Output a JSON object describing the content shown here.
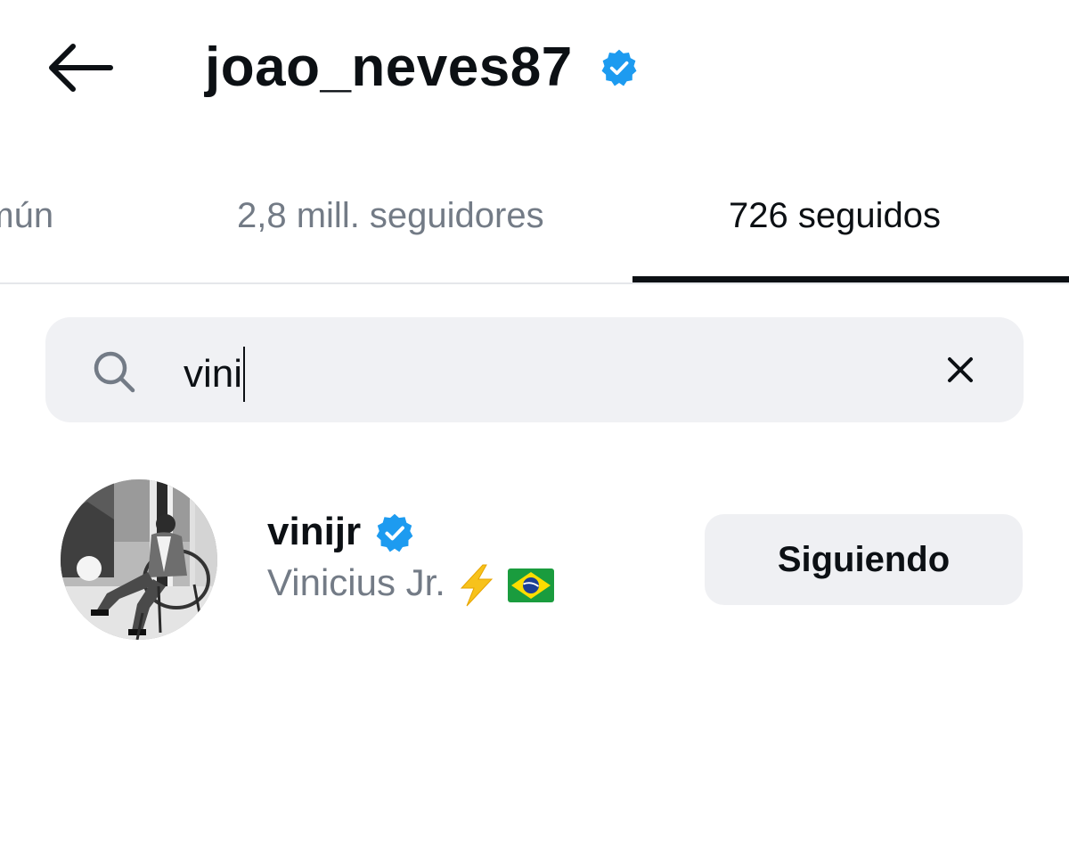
{
  "header": {
    "username": "joao_neves87",
    "verified": true,
    "back_icon": "arrow-left-icon"
  },
  "tabs": [
    {
      "label": "omún",
      "active": false
    },
    {
      "label": "2,8 mill. seguidores",
      "active": false
    },
    {
      "label": "726 seguidos",
      "active": true
    }
  ],
  "search": {
    "value": "vini",
    "icon": "search-icon",
    "clear_icon": "close-icon"
  },
  "results": [
    {
      "username": "vinijr",
      "verified": true,
      "full_name": "Vinicius Jr.",
      "emojis": [
        "lightning-icon",
        "brazil-flag-icon"
      ],
      "button_label": "Siguiendo"
    }
  ],
  "colors": {
    "verified_blue": "#1d9bf0",
    "secondary_text": "#737b86",
    "surface": "#f0f1f4"
  }
}
